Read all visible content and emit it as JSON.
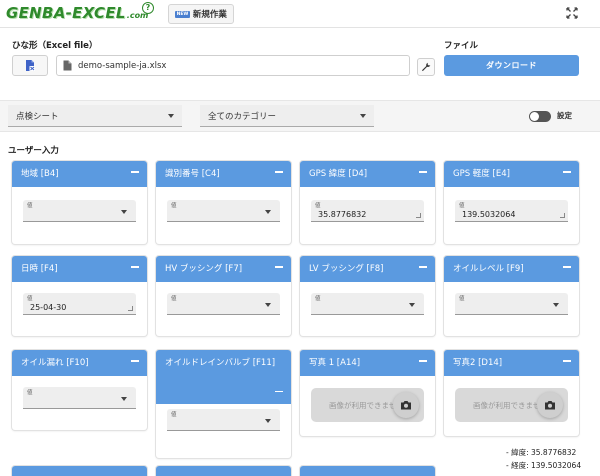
{
  "header": {
    "logo_text": "GENBA-EXCEL",
    "logo_suffix": ".com",
    "logo_badge": "?",
    "new_badge": "NEW",
    "new_task_label": "新規作業"
  },
  "template": {
    "label": "ひな形（Excel file）",
    "file_name": "demo-sample-ja.xlsx"
  },
  "file_section": {
    "label": "ファイル",
    "download_label": "ダウンロード"
  },
  "filters": {
    "sheet_select": "点検シート",
    "category_select": "全てのカテゴリー",
    "toggle_label": "設定"
  },
  "user_input": {
    "label": "ユーザー入力",
    "field_label": "値",
    "photo_placeholder": "画像が利用できません",
    "cards": [
      {
        "title": "地域 [B4]",
        "kind": "select",
        "value": ""
      },
      {
        "title": "識別番号 [C4]",
        "kind": "select",
        "value": ""
      },
      {
        "title": "GPS 緯度 [D4]",
        "kind": "text",
        "value": "35.8776832"
      },
      {
        "title": "GPS 軽度 [E4]",
        "kind": "text",
        "value": "139.5032064"
      },
      {
        "title": "日時 [F4]",
        "kind": "text",
        "value": "25-04-30"
      },
      {
        "title": "HV ブッシング [F7]",
        "kind": "select",
        "value": ""
      },
      {
        "title": "LV ブッシング [F8]",
        "kind": "select",
        "value": ""
      },
      {
        "title": "オイルレベル [F9]",
        "kind": "select",
        "value": ""
      },
      {
        "title": "オイル漏れ [F10]",
        "kind": "select",
        "value": ""
      },
      {
        "title": "オイルドレインバルブ [F11]",
        "kind": "select",
        "value": ""
      },
      {
        "title": "写真 1 [A14]",
        "kind": "photo",
        "value": ""
      },
      {
        "title": "写真2 [D14]",
        "kind": "photo",
        "value": ""
      }
    ],
    "coords": {
      "lat": "- 緯度: 35.8776832",
      "lon": "- 経度: 139.5032064"
    }
  },
  "colors": {
    "accent": "#5b9ae0",
    "logo_green": "#2f8a2c"
  }
}
